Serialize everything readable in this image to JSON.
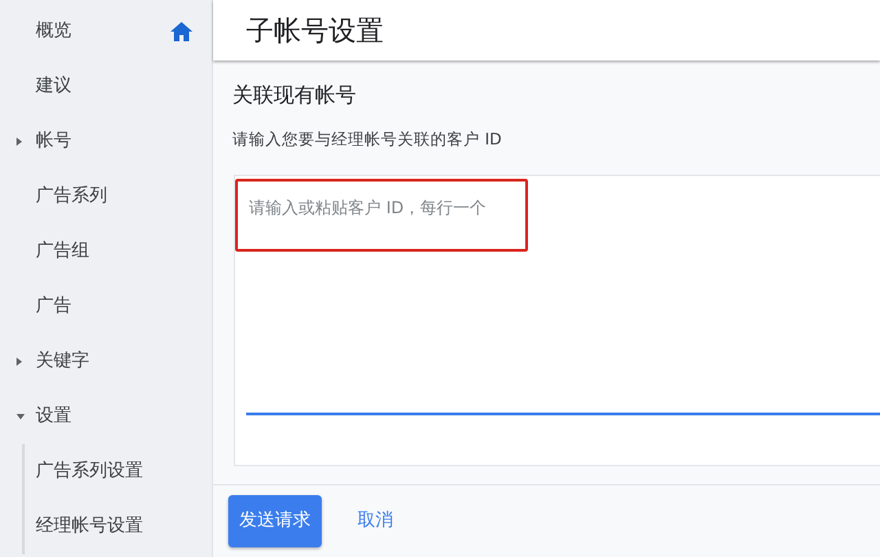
{
  "sidebar": {
    "items": [
      {
        "label": "概览",
        "home": true
      },
      {
        "label": "建议",
        "home": false
      },
      {
        "label": "帐号",
        "home": false,
        "expanded": false
      },
      {
        "label": "广告系列",
        "home": false
      },
      {
        "label": "广告组",
        "home": false
      },
      {
        "label": "广告",
        "home": false
      },
      {
        "label": "关键字",
        "home": false,
        "expanded": false
      },
      {
        "label": "设置",
        "home": false,
        "expanded": true,
        "children": [
          {
            "label": "广告系列设置"
          },
          {
            "label": "经理帐号设置"
          }
        ]
      }
    ]
  },
  "page": {
    "title": "子帐号设置",
    "section_title": "关联现有帐号",
    "description": "请输入您要与经理帐号关联的客户 ID",
    "ids_field": {
      "placeholder": "请输入或粘贴客户 ID，每行一个",
      "highlighted": true
    }
  },
  "buttons": [
    {
      "label": "发送请求",
      "kind": "primary"
    },
    {
      "label": "取消",
      "kind": "link"
    }
  ]
}
